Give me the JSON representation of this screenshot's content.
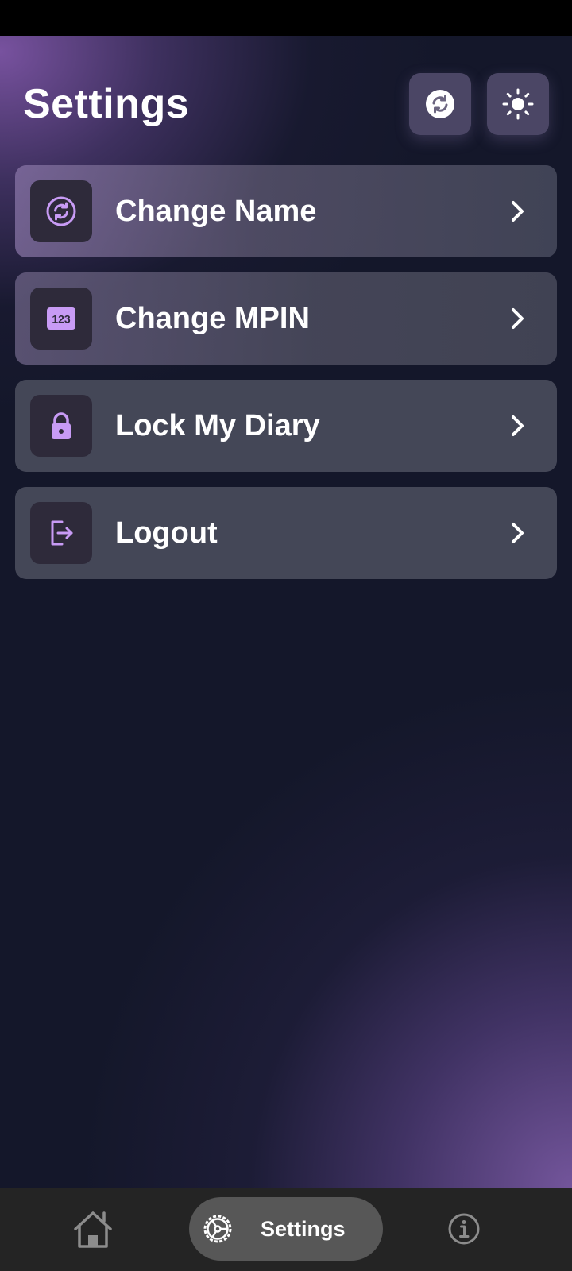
{
  "page": {
    "title": "Settings"
  },
  "top_actions": [
    {
      "icon": "sync-icon",
      "action": "sync"
    },
    {
      "icon": "sun-icon",
      "action": "theme-toggle"
    }
  ],
  "menu": {
    "items": [
      {
        "label": "Change Name",
        "icon": "sync-circle-icon"
      },
      {
        "label": "Change MPIN",
        "icon": "numeric-123-icon",
        "icon_text": "123"
      },
      {
        "label": "Lock My Diary",
        "icon": "lock-icon"
      },
      {
        "label": "Logout",
        "icon": "logout-icon"
      }
    ]
  },
  "bottom_nav": {
    "items": [
      {
        "icon": "home-icon",
        "label": ""
      },
      {
        "icon": "gear-icon",
        "label": "Settings",
        "active": true
      },
      {
        "icon": "info-icon",
        "label": ""
      }
    ]
  },
  "colors": {
    "accent": "#c89bf5",
    "background": "#14172a",
    "nav_background": "#242424",
    "nav_active": "#575757"
  }
}
